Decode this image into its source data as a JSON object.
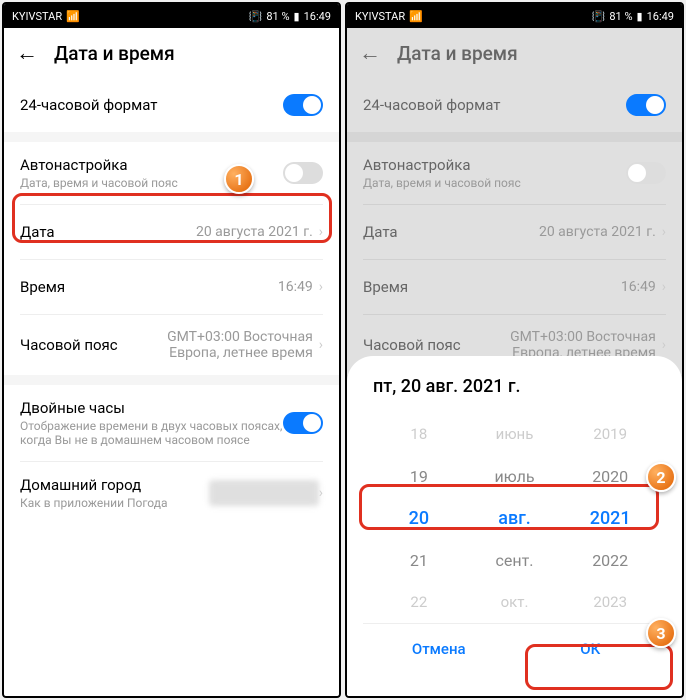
{
  "statusbar": {
    "carrier": "KYIVSTAR",
    "battery": "81 %",
    "time": "16:49"
  },
  "header": {
    "title": "Дата и время"
  },
  "rows": {
    "format24": {
      "label": "24-часовой формат"
    },
    "autoset": {
      "label": "Автонастройка",
      "sub": "Дата, время и часовой пояс"
    },
    "date": {
      "label": "Дата",
      "value": "20 августа 2021 г."
    },
    "time": {
      "label": "Время",
      "value": "16:49"
    },
    "tz": {
      "label": "Часовой пояс",
      "value": "GMT+03:00 Восточная Европа, летнее время"
    },
    "dualclock": {
      "label": "Двойные часы",
      "sub": "Отображение времени в двух часовых поясах, когда Вы не в домашнем часовом поясе"
    },
    "homecity": {
      "label": "Домашний город",
      "sub": "Как в приложении Погода"
    }
  },
  "picker": {
    "title": "пт, 20 авг. 2021 г.",
    "days": [
      "18",
      "19",
      "20",
      "21",
      "22"
    ],
    "months": [
      "июнь",
      "июль",
      "авг.",
      "сент.",
      "окт."
    ],
    "years": [
      "2019",
      "2020",
      "2021",
      "2022",
      "2023"
    ],
    "cancel": "Отмена",
    "ok": "ОК"
  },
  "badges": {
    "b1": "1",
    "b2": "2",
    "b3": "3"
  }
}
